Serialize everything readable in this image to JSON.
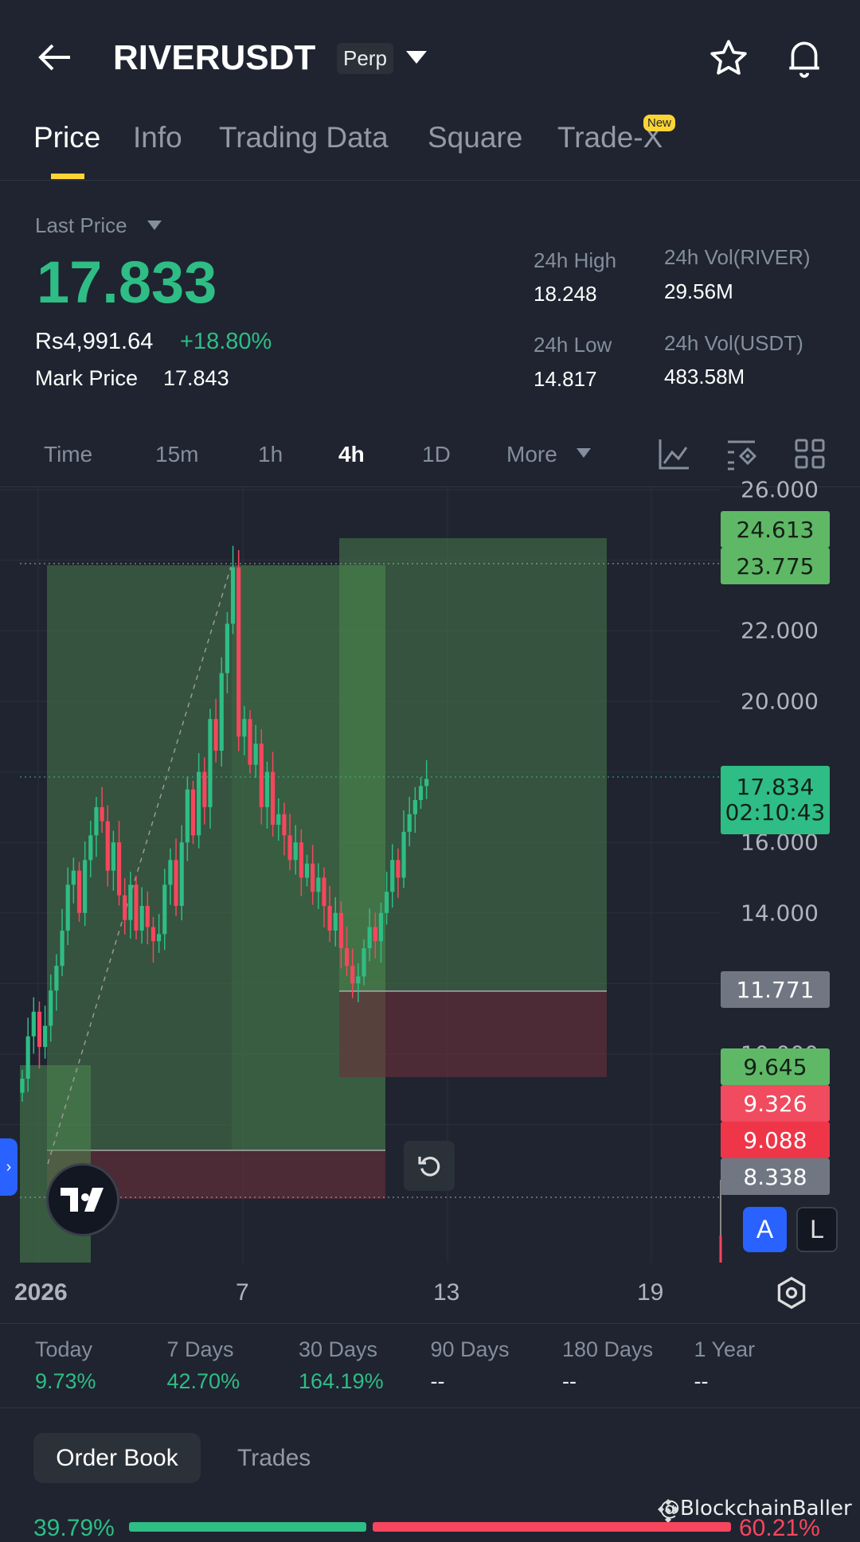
{
  "header": {
    "title": "RIVERUSDT",
    "contract_type": "Perp"
  },
  "tabs": [
    {
      "label": "Price"
    },
    {
      "label": "Info"
    },
    {
      "label": "Trading Data"
    },
    {
      "label": "Square"
    },
    {
      "label": "Trade-X",
      "badge": "New"
    }
  ],
  "price": {
    "label": "Last Price",
    "last": "17.833",
    "fiat": "Rs4,991.64",
    "change": "+18.80%",
    "mark_label": "Mark Price",
    "mark": "17.843"
  },
  "stats": {
    "high_label": "24h High",
    "high": "18.248",
    "low_label": "24h Low",
    "low": "14.817",
    "vol_base_label": "24h Vol(RIVER)",
    "vol_base": "29.56M",
    "vol_quote_label": "24h Vol(USDT)",
    "vol_quote": "483.58M"
  },
  "timeframes": [
    "Time",
    "15m",
    "1h",
    "4h",
    "1D",
    "More"
  ],
  "active_timeframe": "4h",
  "chart_data": {
    "type": "candlestick",
    "interval": "4h",
    "ylim": [
      8,
      26
    ],
    "y_ticks": [
      "26.000",
      "22.000",
      "20.000",
      "16.000",
      "14.000",
      "10.000"
    ],
    "x_ticks": [
      "2026",
      "7",
      "13",
      "19"
    ],
    "closes": [
      9.3,
      10.5,
      11.2,
      10.2,
      10.8,
      11.8,
      12.5,
      13.5,
      14.8,
      15.2,
      14.0,
      15.5,
      16.2,
      17.0,
      16.6,
      15.2,
      16.0,
      14.5,
      13.8,
      14.8,
      13.5,
      14.2,
      13.6,
      13.2,
      13.4,
      14.8,
      15.5,
      14.2,
      16.0,
      17.5,
      16.2,
      18.0,
      17.0,
      19.5,
      18.6,
      20.8,
      22.2,
      23.8,
      19.0,
      19.5,
      18.2,
      18.8,
      17.0,
      18.0,
      16.5,
      16.8,
      16.2,
      15.5,
      16.0,
      15.0,
      15.4,
      14.6,
      15.0,
      14.2,
      13.5,
      14.0,
      13.0,
      12.5,
      12.0,
      12.2,
      13.0,
      13.6,
      13.2,
      14.0,
      14.6,
      15.5,
      15.0,
      16.3,
      16.8,
      17.2,
      17.6,
      17.8
    ],
    "price_tags": [
      {
        "value": "24.613",
        "color": "#5fb866"
      },
      {
        "value": "23.775",
        "color": "#5fb866"
      },
      {
        "value": "17.834",
        "countdown": "02:10:43",
        "color": "#2ebd85"
      },
      {
        "value": "11.771",
        "color": "#707783"
      },
      {
        "value": "9.645",
        "color": "#5fb866"
      },
      {
        "value": "9.326",
        "color": "#f04b5e"
      },
      {
        "value": "9.088",
        "color": "#ee3648"
      },
      {
        "value": "8.338",
        "color": "#707783"
      }
    ],
    "up_color": "#2ebd85",
    "down_color": "#f6465d"
  },
  "scale_buttons": {
    "auto": "A",
    "log": "L"
  },
  "performance": [
    {
      "label": "Today",
      "value": "9.73%"
    },
    {
      "label": "7 Days",
      "value": "42.70%"
    },
    {
      "label": "30 Days",
      "value": "164.19%"
    },
    {
      "label": "90 Days",
      "value": "--"
    },
    {
      "label": "180 Days",
      "value": "--"
    },
    {
      "label": "1 Year",
      "value": "--"
    }
  ],
  "bottom_tabs": [
    "Order Book",
    "Trades"
  ],
  "orderbook": {
    "bid_pct": "39.79%",
    "ask_pct": "60.21%",
    "bid_ratio": 0.3979
  },
  "watermark": "@BlockchainBaller"
}
